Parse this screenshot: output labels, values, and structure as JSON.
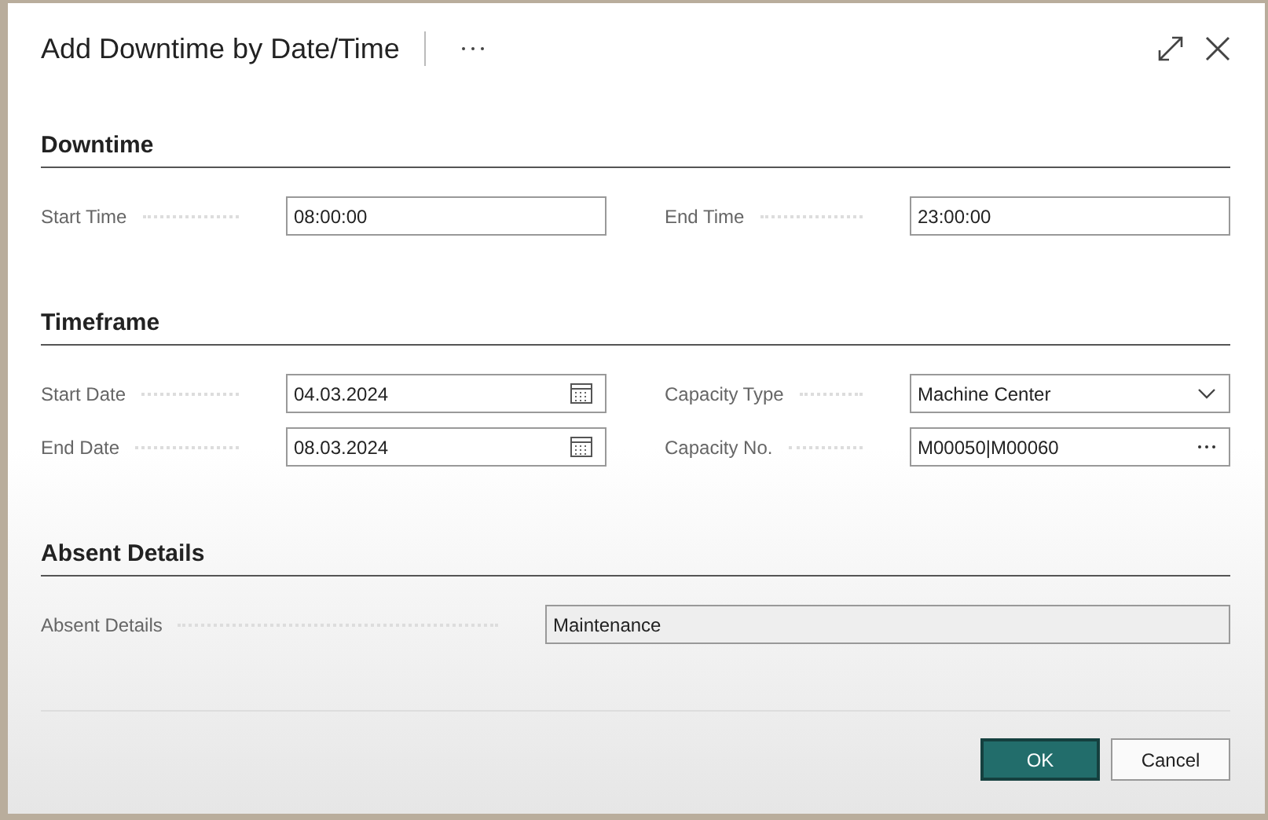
{
  "dialog": {
    "title": "Add Downtime by Date/Time"
  },
  "sections": [
    {
      "heading": "Downtime",
      "kind": "pair",
      "fields": [
        {
          "label": "Start Time",
          "value": "08:00:00",
          "kind": "text"
        },
        {
          "label": "End Time",
          "value": "23:00:00",
          "kind": "text"
        }
      ]
    },
    {
      "heading": "Timeframe",
      "kind": "pair",
      "fields": [
        {
          "label": "Start Date",
          "value": "04.03.2024",
          "kind": "date"
        },
        {
          "label": "Capacity Type",
          "value": "Machine Center",
          "kind": "select"
        },
        {
          "label": "End Date",
          "value": "08.03.2024",
          "kind": "date"
        },
        {
          "label": "Capacity No.",
          "value": "M00050|M00060",
          "kind": "lookup"
        }
      ]
    },
    {
      "heading": "Absent Details",
      "kind": "wide",
      "fields": [
        {
          "label": "Absent Details",
          "value": "Maintenance",
          "kind": "text"
        }
      ]
    }
  ],
  "buttons": [
    {
      "label": "OK",
      "kind": "primary"
    },
    {
      "label": "Cancel",
      "kind": "secondary"
    }
  ]
}
